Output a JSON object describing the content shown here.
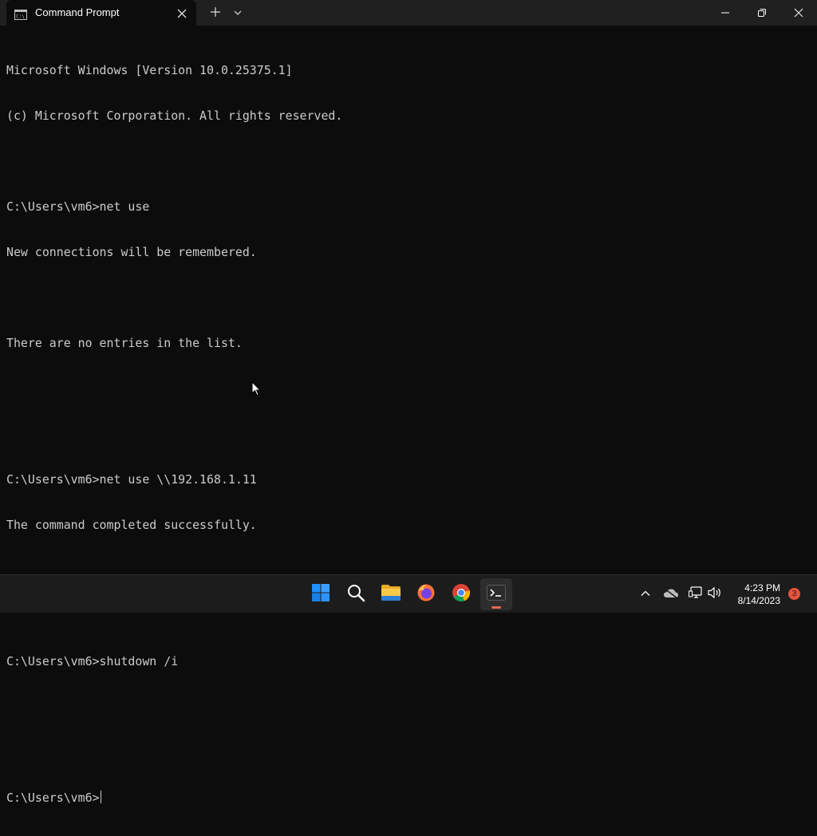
{
  "window": {
    "tab_title": "Command Prompt",
    "icons": {
      "tab_icon": "cmd-icon",
      "close_tab": "close-icon",
      "new_tab": "plus-icon",
      "dropdown": "chevron-down-icon",
      "minimize": "minimize-icon",
      "maximize": "maximize-icon",
      "close": "close-icon"
    }
  },
  "console": {
    "lines": [
      "Microsoft Windows [Version 10.0.25375.1]",
      "(c) Microsoft Corporation. All rights reserved.",
      "",
      "C:\\Users\\vm6>net use",
      "New connections will be remembered.",
      "",
      "There are no entries in the list.",
      "",
      "",
      "C:\\Users\\vm6>net use \\\\192.168.1.11",
      "The command completed successfully.",
      "",
      "",
      "C:\\Users\\vm6>shutdown /i",
      "",
      "",
      "C:\\Users\\vm6>"
    ]
  },
  "taskbar": {
    "apps": [
      {
        "name": "start-icon"
      },
      {
        "name": "search-icon"
      },
      {
        "name": "file-explorer-icon"
      },
      {
        "name": "firefox-icon"
      },
      {
        "name": "chrome-icon"
      },
      {
        "name": "terminal-icon",
        "active": true
      }
    ],
    "tray": [
      "chevron-up-icon",
      "onedrive-offline-icon",
      "network-icon",
      "volume-icon"
    ],
    "time": "4:23 PM",
    "date": "8/14/2023",
    "notification_count": "3"
  },
  "colors": {
    "console_bg": "#0c0c0c",
    "console_fg": "#cccccc",
    "titlebar_bg": "#202020",
    "taskbar_bg": "#1c1c1c",
    "accent_active": "#e26a4f",
    "badge": "#e7543b"
  }
}
